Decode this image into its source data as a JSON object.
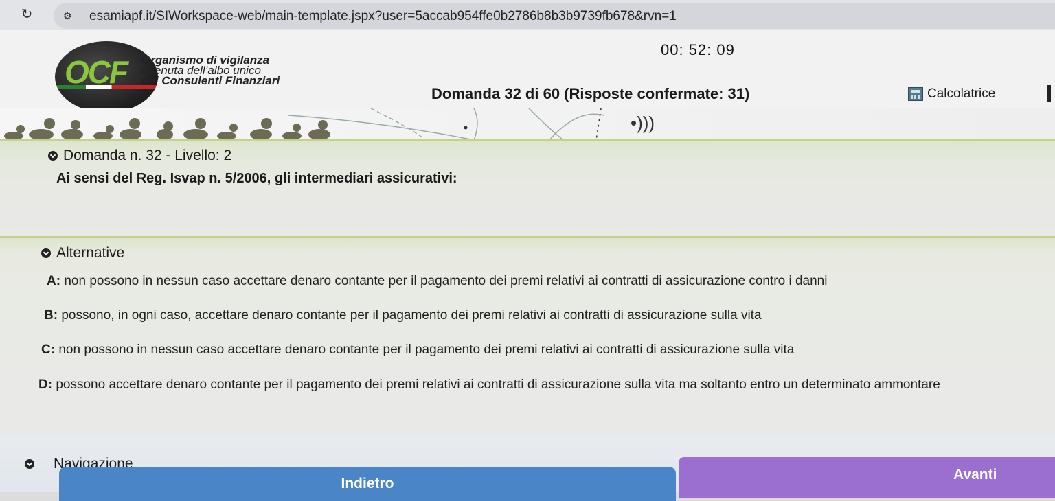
{
  "browser": {
    "url": "esamiapf.it/SIWorkspace-web/main-template.jspx?user=5accab954ffe0b2786b8b3b9739fb678&rvn=1"
  },
  "header": {
    "logo_text": "OCF",
    "org_line1": "Organismo di vigilanza",
    "org_line2": "e tenuta dell’albo unico",
    "org_line3": "dei Consulenti Finanziari",
    "timer": "00: 52: 09",
    "question_counter": "Domanda 32 di 60 (Risposte confermate: 31)",
    "calculator_label": "Calcolatrice"
  },
  "question": {
    "title": "Domanda n. 32 - Livello: 2",
    "text": "Ai sensi del Reg. Isvap n. 5/2006, gli intermediari assicurativi:"
  },
  "alternatives": {
    "title": "Alternative",
    "options": [
      {
        "letter": "A:",
        "text": " non possono in nessun caso accettare denaro contante per il pagamento dei premi relativi ai contratti di assicurazione contro i danni"
      },
      {
        "letter": "B:",
        "text": " possono, in ogni caso, accettare denaro contante per il pagamento dei premi relativi ai contratti di assicurazione sulla vita"
      },
      {
        "letter": "C:",
        "text": " non possono in nessun caso accettare denaro contante per il pagamento dei premi relativi ai contratti di assicurazione sulla vita"
      },
      {
        "letter": "D:",
        "text": " possono accettare denaro contante per il pagamento dei premi relativi ai contratti di assicurazione sulla vita ma soltanto entro un determinato ammontare"
      }
    ]
  },
  "navigation": {
    "title": "Navigazione",
    "back_label": "Indietro",
    "next_label": "Avanti"
  },
  "colors": {
    "back_button": "#4a86c7",
    "next_button": "#9b6fd0",
    "logo_green": "#8cc63f"
  }
}
